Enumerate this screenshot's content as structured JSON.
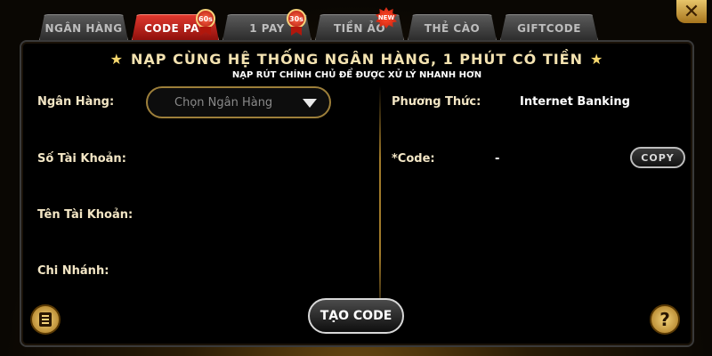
{
  "tabs": [
    {
      "label": "NGÂN HÀNG",
      "active": false
    },
    {
      "label": "CODE PAY",
      "active": true,
      "badge": "60s"
    },
    {
      "label": "1 PAY",
      "active": false,
      "badge": "30s"
    },
    {
      "label": "TIỀN ẢO",
      "active": false,
      "badge": "NEW"
    },
    {
      "label": "THẺ CÀO",
      "active": false
    },
    {
      "label": "GIFTCODE",
      "active": false
    }
  ],
  "header": {
    "title": "NẠP CÙNG HỆ THỐNG NGÂN HÀNG, 1 PHÚT CÓ TIỀN",
    "star": "★",
    "subtitle": "NẠP RÚT CHÍNH CHỦ ĐỂ ĐƯỢC XỬ LÝ NHANH HƠN"
  },
  "form_left": {
    "bank_label": "Ngân Hàng:",
    "bank_select_value": "Chọn Ngân Hàng",
    "account_number_label": "Số Tài Khoản:",
    "account_name_label": "Tên Tài Khoản:",
    "branch_label": "Chi Nhánh:"
  },
  "form_right": {
    "method_label": "Phương Thức:",
    "method_value": "Internet Banking",
    "code_label": "*Code:",
    "code_value": "-",
    "copy_label": "COPY"
  },
  "actions": {
    "create_code_label": "TẠO CODE",
    "close_glyph": "✕",
    "help_glyph": "?"
  },
  "colors": {
    "active_tab": "#c8231b",
    "accent_gold": "#d9b25a",
    "panel_bg": "#000000"
  }
}
